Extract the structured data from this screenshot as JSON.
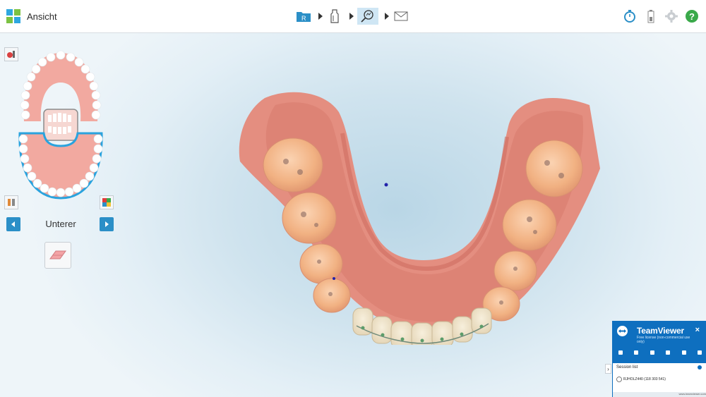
{
  "app": {
    "title": "Ansicht"
  },
  "left_panel": {
    "jaw_label": "Unterer",
    "prev_label": "◀",
    "next_label": "▶"
  },
  "teamviewer": {
    "title": "TeamViewer",
    "subtitle": "Free license (non-commercial use only)",
    "close": "×",
    "session_list": "Session list",
    "session_name": "RJHOLZ440 (118 303 541)",
    "footer": "www.teamviewer.com",
    "expand": "›"
  },
  "colors": {
    "accent": "#2b8fc7",
    "teamviewer_blue": "#0e6fbf",
    "gum": "#e89a8c",
    "tooth": "#f2b48a",
    "jaw_outline": "#2aa3de"
  },
  "icons": [
    "app-grid-icon",
    "folder-r-icon",
    "scanner-icon",
    "magnify-icon",
    "envelope-icon",
    "stopwatch-icon",
    "battery-icon",
    "gear-icon",
    "help-icon",
    "eraser-icon"
  ]
}
